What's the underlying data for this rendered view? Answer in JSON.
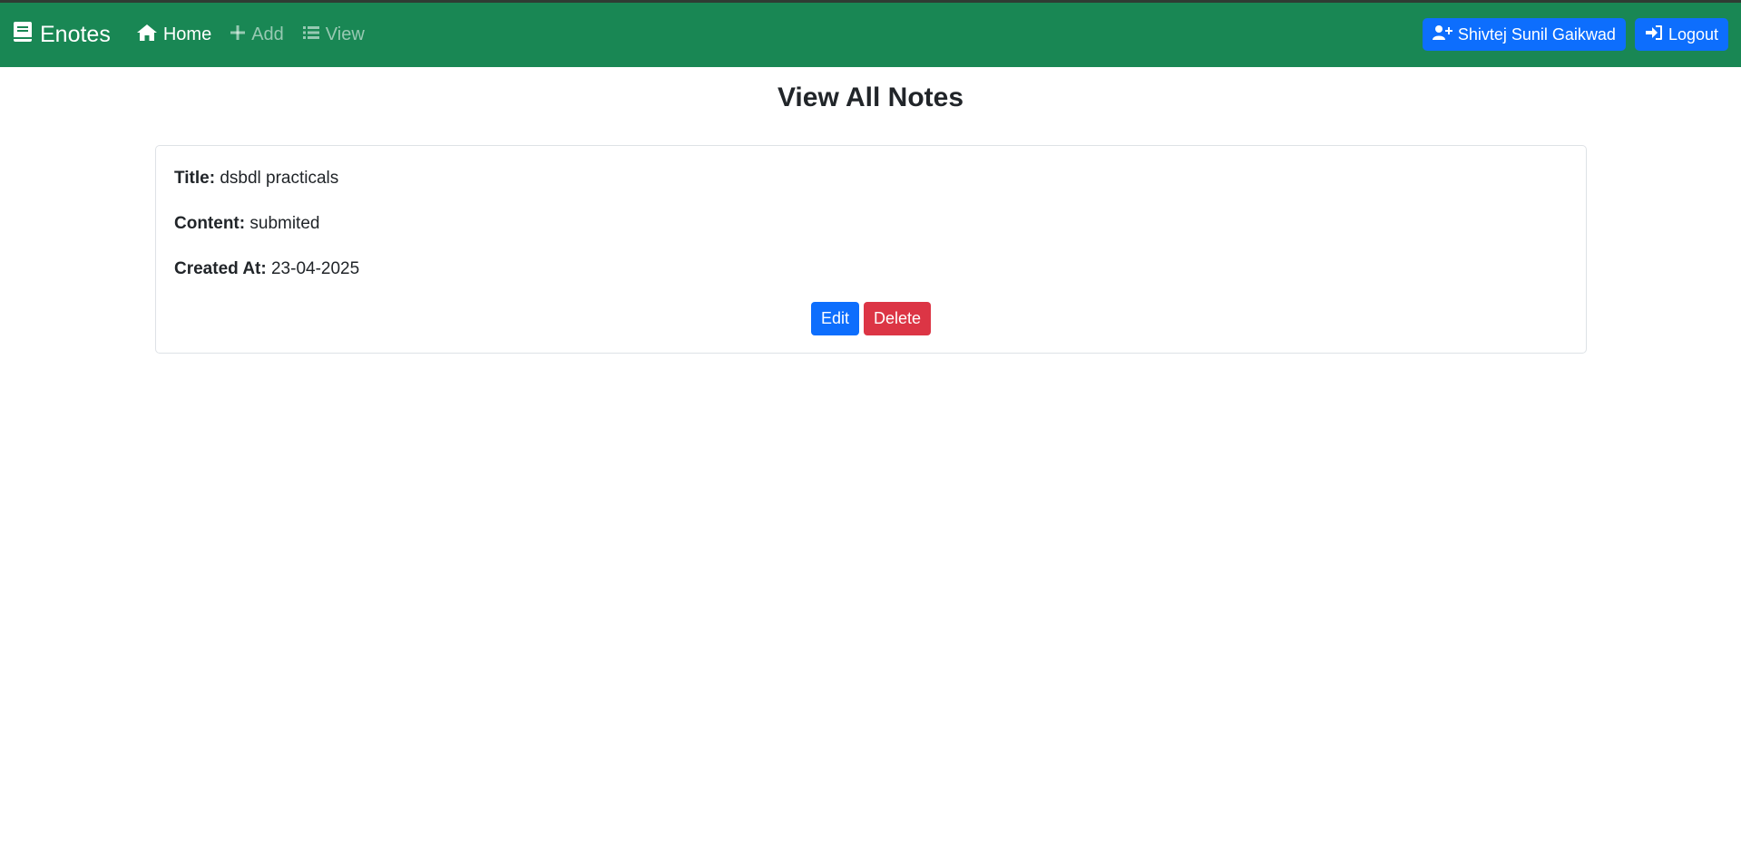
{
  "navbar": {
    "brand": "Enotes",
    "brand_icon": "book-icon",
    "links": [
      {
        "label": "Home",
        "icon": "home-icon",
        "active": true
      },
      {
        "label": "Add",
        "icon": "plus-icon",
        "active": false
      },
      {
        "label": "View",
        "icon": "list-icon",
        "active": false
      }
    ],
    "user_label": "Shivtej Sunil Gaikwad",
    "user_icon": "user-plus-icon",
    "logout_label": "Logout",
    "logout_icon": "sign-in-icon",
    "color": "#198754"
  },
  "main": {
    "title": "View All Notes",
    "note": {
      "title_label": "Title:",
      "title_value": "dsbdl practicals",
      "content_label": "Content:",
      "content_value": "submited",
      "created_label": "Created At:",
      "created_value": "23-04-2025",
      "edit_label": "Edit",
      "delete_label": "Delete"
    }
  },
  "colors": {
    "primary": "#0d6efd",
    "danger": "#dc3545"
  }
}
